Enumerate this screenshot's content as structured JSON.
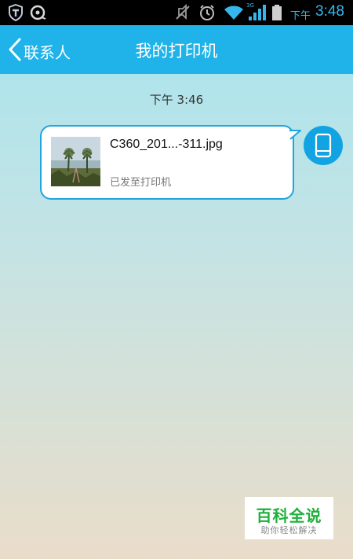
{
  "status_bar": {
    "ampm": "下午",
    "time": "3:48",
    "network_label": "3G",
    "icons": [
      "shield-icon",
      "disk-icon",
      "mute-icon",
      "alarm-icon",
      "wifi-icon",
      "signal-icon",
      "battery-icon"
    ],
    "accent_color": "#35b6ec"
  },
  "header": {
    "back_label": "联系人",
    "title": "我的打印机",
    "background_color": "#1fb3e9"
  },
  "conversation": {
    "timestamp": "下午 3:46",
    "message": {
      "file_name": "C360_201...-311.jpg",
      "status": "已发至打印机",
      "border_color": "#1fa6df"
    },
    "sender_icon": "phone-icon",
    "avatar_color": "#12a4e2"
  },
  "watermark": {
    "title": "百科全说",
    "subtitle": "助你轻松解决"
  }
}
